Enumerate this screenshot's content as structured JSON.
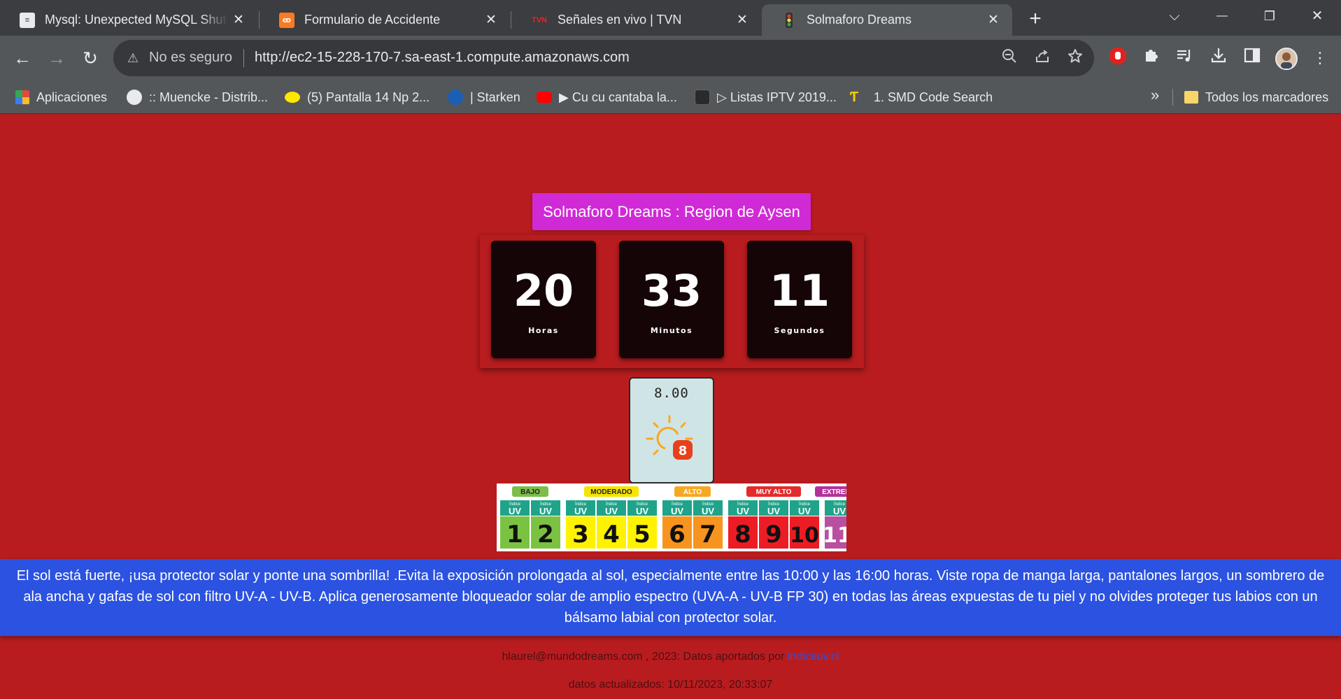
{
  "tabs": [
    {
      "title": "Mysql: Unexpected MySQL Shutdown",
      "icon": "document-icon",
      "active": false
    },
    {
      "title": "Formulario de Accidente",
      "icon": "xampp-icon",
      "active": false
    },
    {
      "title": "Señales en vivo | TVN",
      "icon": "tvn-icon",
      "active": false
    },
    {
      "title": "Solmaforo Dreams",
      "icon": "traffic-light-icon",
      "active": true
    }
  ],
  "tab_close_glyph": "✕",
  "new_tab_glyph": "+",
  "window_controls": {
    "dropdown": "⌵",
    "minimize": "—",
    "restore": "❐",
    "close": "✕"
  },
  "nav": {
    "back": "←",
    "forward": "→",
    "reload": "↻"
  },
  "address": {
    "warning_glyph": "⚠",
    "security_label": "No es seguro",
    "url": "http://ec2-15-228-170-7.sa-east-1.compute.amazonaws.com"
  },
  "bookmarks": [
    {
      "label": "Aplicaciones",
      "icon": "apps-grid-icon",
      "color": "#e8453c"
    },
    {
      "label": ":: Muencke - Distrib...",
      "icon": "globe-icon",
      "color": "#e8eaed"
    },
    {
      "label": "(5) Pantalla 14 Np 2...",
      "icon": "mercadolibre-icon",
      "color": "#ffe600"
    },
    {
      "label": "| Starken",
      "icon": "starken-icon",
      "color": "#1a5fb4"
    },
    {
      "label": "▶ Cu cu cantaba la...",
      "icon": "youtube-icon",
      "color": "#ff0000"
    },
    {
      "label": "▷ Listas IPTV 2019...",
      "icon": "film-icon",
      "color": "#3d3d3d"
    },
    {
      "label": "1. SMD Code Search",
      "icon": "smd-icon",
      "color": "#f5d000"
    }
  ],
  "bookmarks_more": "»",
  "bookmarks_folder": "Todos los marcadores",
  "page": {
    "heading": "Solmaforo Dreams : Region de Aysen",
    "clock": [
      {
        "value": "20",
        "label": "Horas"
      },
      {
        "value": "33",
        "label": "Minutos"
      },
      {
        "value": "11",
        "label": "Segundos"
      }
    ],
    "uv_value": "8.00",
    "uv_badge": "8",
    "uv_scale": {
      "categories": [
        {
          "name": "BAJO",
          "color": "#7dbd4a",
          "levels": [
            "1",
            "2"
          ],
          "level_color": "#7cc242"
        },
        {
          "name": "MODERADO",
          "color": "#f5e500",
          "levels": [
            "3",
            "4",
            "5"
          ],
          "level_color": "#fff200"
        },
        {
          "name": "ALTO",
          "color": "#f7a823",
          "levels": [
            "6",
            "7"
          ],
          "level_color": "#f7941d"
        },
        {
          "name": "MUY ALTO",
          "color": "#e32b2b",
          "levels": [
            "8",
            "9",
            "10"
          ],
          "level_color": "#ed1c24"
        },
        {
          "name": "EXTREMO",
          "color": "#b2329a",
          "levels": [
            "11"
          ],
          "level_color": "#b84fa1"
        }
      ],
      "uv_tag_top": "Índice",
      "uv_tag": "UV",
      "extreme_plus": "+"
    },
    "advice": "El sol está fuerte, ¡usa protector solar y ponte una sombrilla! .Evita la exposición prolongada al sol, especialmente entre las 10:00 y las 16:00 horas. Viste ropa de manga larga, pantalones largos, un sombrero de ala ancha y gafas de sol con filtro UV-A - UV-B. Aplica generosamente bloqueador solar de amplio espectro (UVA-A - UV-B FP 30) en todas las áreas expuestas de tu piel y no olvides proteger tus labios con un bálsamo labial con protector solar.",
    "footer_text": "hlaurel@mundodreams.com , 2023: Datos aportados por",
    "footer_link": "indiceuv.cl",
    "updated": "datos actualizados: 10/11/2023, 20:33:07"
  },
  "colors": {
    "page_bg": "#b81c1f",
    "heading_bg": "#d02ad6",
    "clock_box": "#150506",
    "advice_bg": "#2b52e0",
    "uv_card_bg": "#cfe4e5",
    "sun": "#f7a823",
    "badge": "#e8401c"
  }
}
